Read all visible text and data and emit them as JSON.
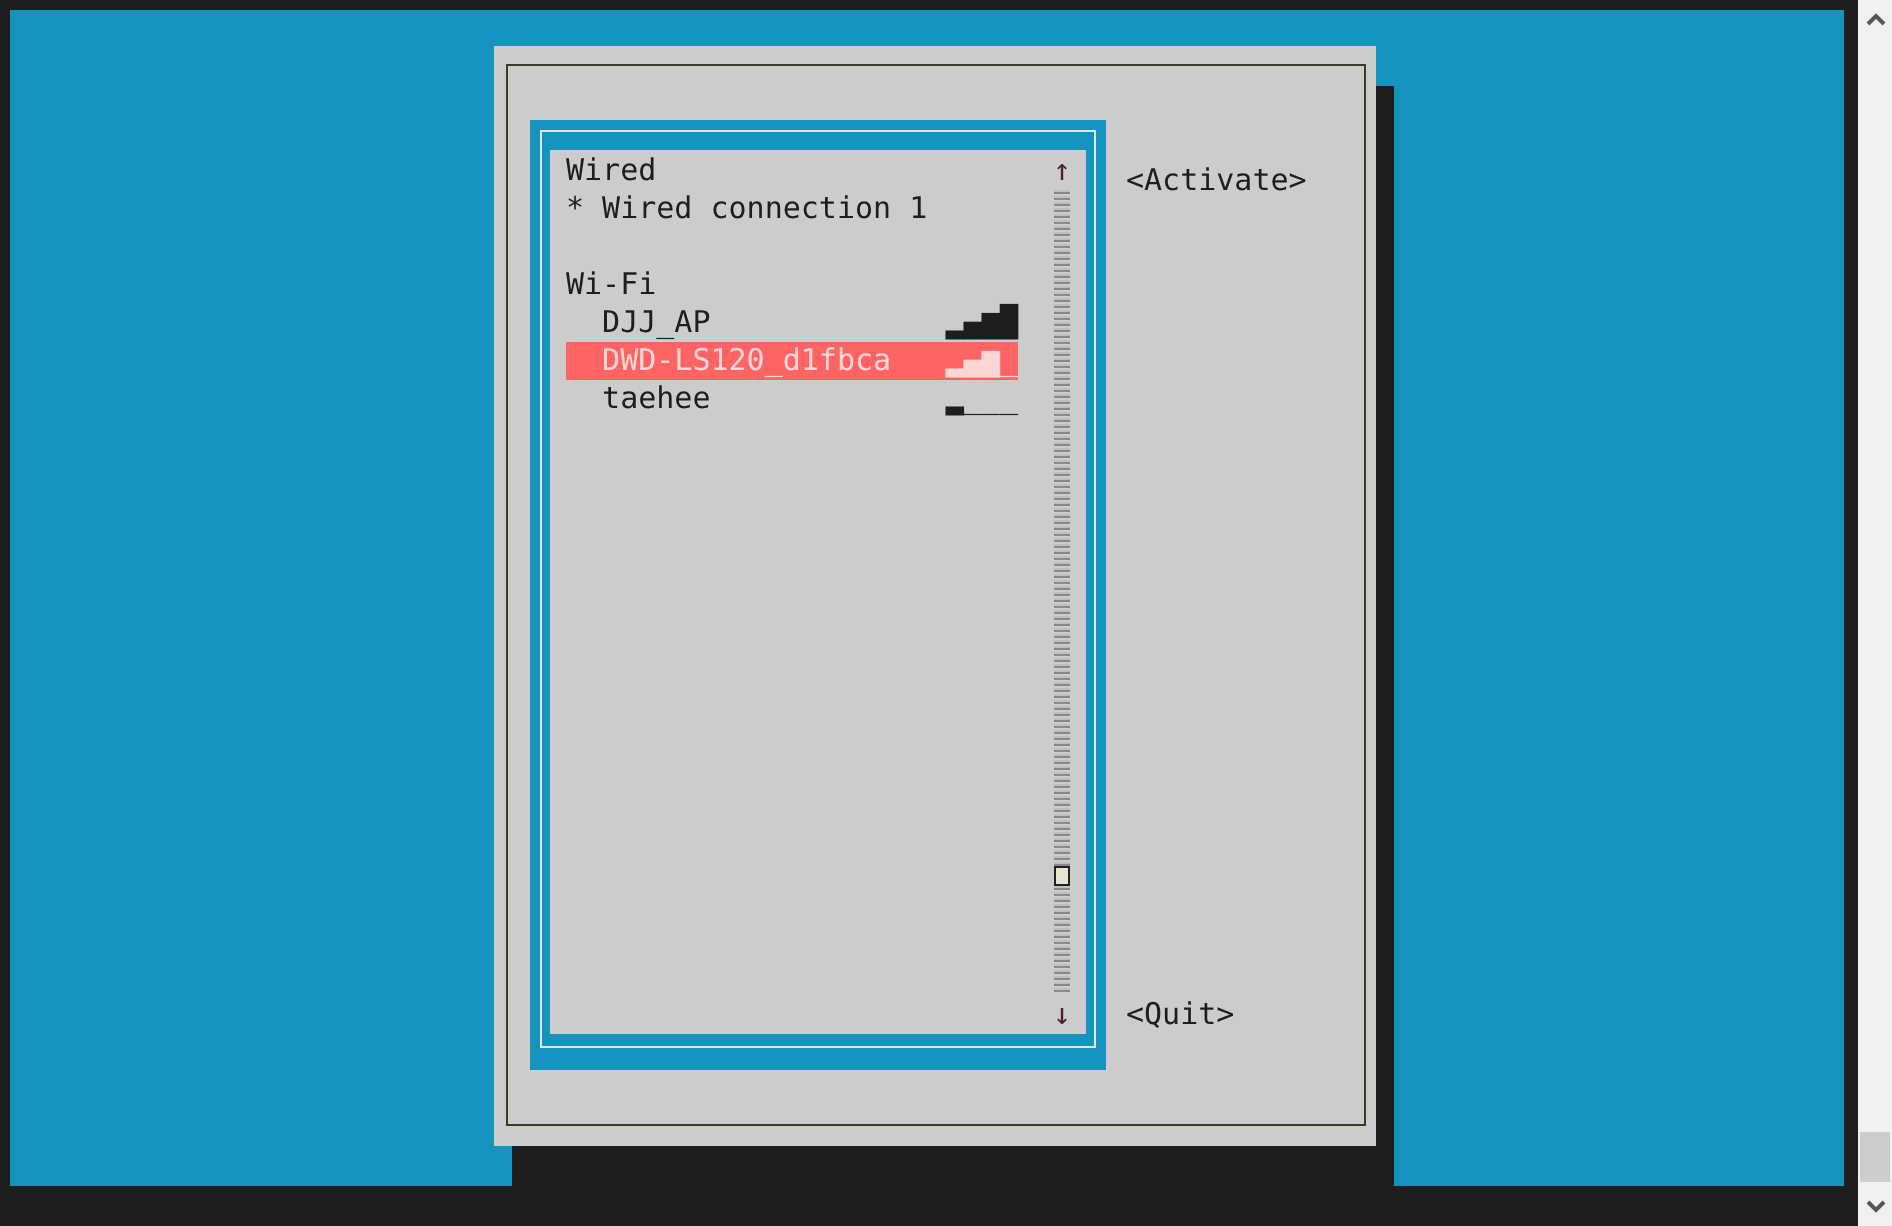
{
  "list": {
    "sections": [
      {
        "title": "Wired",
        "items": [
          {
            "mark": "*",
            "name": "Wired connection 1",
            "selected": false
          }
        ]
      },
      {
        "title": "Wi-Fi",
        "items": [
          {
            "name": "DJJ_AP",
            "signal": "▂▄▆█",
            "selected": false
          },
          {
            "name": "DWD-LS120_d1fbca",
            "signal": "▂▄▆_",
            "selected": true
          },
          {
            "name": "taehee",
            "signal": "▂___",
            "selected": false
          }
        ]
      }
    ],
    "scroll_up": "↑",
    "scroll_down": "↓"
  },
  "buttons": [
    "<Activate>",
    "<Quit>"
  ]
}
